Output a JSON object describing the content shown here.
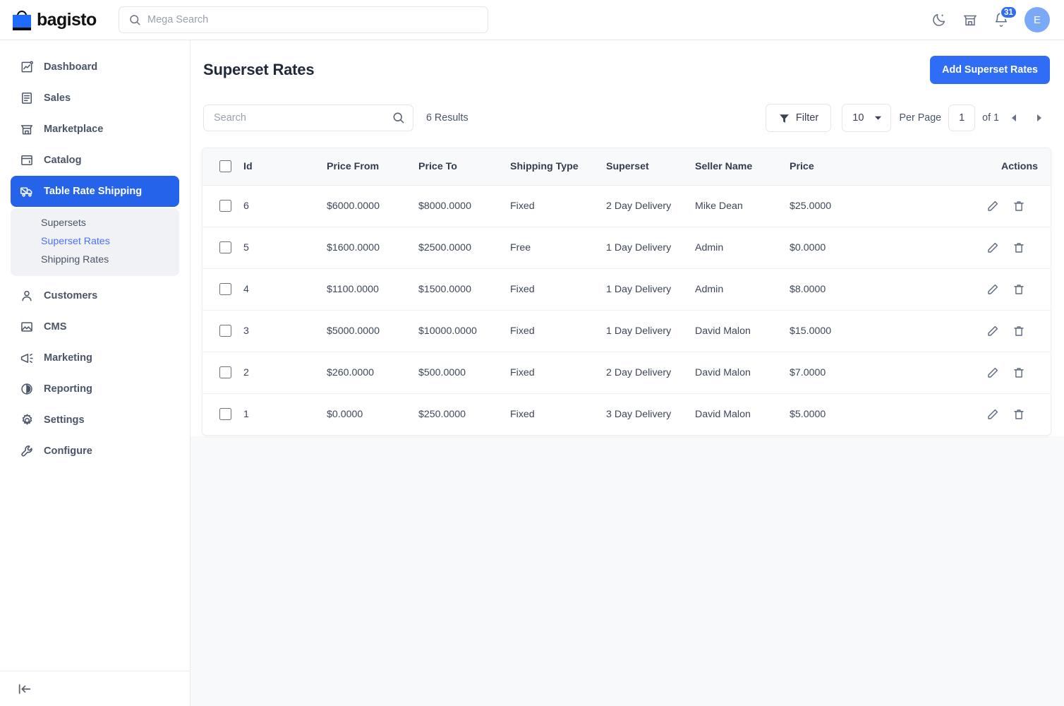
{
  "header": {
    "brand": "bagisto",
    "brand_logo_color": "#1f6bff",
    "mega_search_placeholder": "Mega Search",
    "icons": {
      "search": "search-icon",
      "dark_mode": "moon-icon",
      "store": "store-icon",
      "notifications": "bell-icon"
    },
    "notification_count": "31",
    "avatar_initial": "E"
  },
  "sidebar": {
    "items": [
      {
        "label": "Dashboard",
        "icon": "dashboard-chart-icon",
        "active": false
      },
      {
        "label": "Sales",
        "icon": "sales-list-icon",
        "active": false
      },
      {
        "label": "Marketplace",
        "icon": "marketplace-store-icon",
        "active": false
      },
      {
        "label": "Catalog",
        "icon": "catalog-window-icon",
        "active": false
      },
      {
        "label": "Table Rate Shipping",
        "icon": "truck-icon",
        "active": true
      },
      {
        "label": "Customers",
        "icon": "user-icon",
        "active": false
      },
      {
        "label": "CMS",
        "icon": "image-icon",
        "active": false
      },
      {
        "label": "Marketing",
        "icon": "megaphone-icon",
        "active": false
      },
      {
        "label": "Reporting",
        "icon": "pie-chart-icon",
        "active": false
      },
      {
        "label": "Settings",
        "icon": "gear-icon",
        "active": false
      },
      {
        "label": "Configure",
        "icon": "wrench-icon",
        "active": false
      }
    ],
    "submenu": [
      {
        "label": "Supersets",
        "active": false
      },
      {
        "label": "Superset Rates",
        "active": true
      },
      {
        "label": "Shipping Rates",
        "active": false
      }
    ],
    "collapse_icon": "collapse-sidebar-icon",
    "active_color": "#2563eb",
    "submenu_active_color": "#4c6fff"
  },
  "page": {
    "title": "Superset Rates",
    "add_button": "Add Superset Rates",
    "add_button_color": "#2f6df6"
  },
  "toolbar": {
    "search_placeholder": "Search",
    "search_value": "",
    "results_label": "6 Results",
    "filter_label": "Filter",
    "per_page_value": "10",
    "per_page_label": "Per Page",
    "page_value": "1",
    "of_label": "of 1",
    "prev_icon": "chevron-left-icon",
    "next_icon": "chevron-right-icon"
  },
  "table": {
    "columns": [
      "Id",
      "Price From",
      "Price To",
      "Shipping Type",
      "Superset",
      "Seller Name",
      "Price",
      "Actions"
    ],
    "rows": [
      {
        "id": "6",
        "price_from": "$6000.0000",
        "price_to": "$8000.0000",
        "shipping_type": "Fixed",
        "superset": "2 Day Delivery",
        "seller_name": "Mike Dean",
        "price": "$25.0000"
      },
      {
        "id": "5",
        "price_from": "$1600.0000",
        "price_to": "$2500.0000",
        "shipping_type": "Free",
        "superset": "1 Day Delivery",
        "seller_name": "Admin",
        "price": "$0.0000"
      },
      {
        "id": "4",
        "price_from": "$1100.0000",
        "price_to": "$1500.0000",
        "shipping_type": "Fixed",
        "superset": "1 Day Delivery",
        "seller_name": "Admin",
        "price": "$8.0000"
      },
      {
        "id": "3",
        "price_from": "$5000.0000",
        "price_to": "$10000.0000",
        "shipping_type": "Fixed",
        "superset": "1 Day Delivery",
        "seller_name": "David Malon",
        "price": "$15.0000"
      },
      {
        "id": "2",
        "price_from": "$260.0000",
        "price_to": "$500.0000",
        "shipping_type": "Fixed",
        "superset": "2 Day Delivery",
        "seller_name": "David Malon",
        "price": "$7.0000"
      },
      {
        "id": "1",
        "price_from": "$0.0000",
        "price_to": "$250.0000",
        "shipping_type": "Fixed",
        "superset": "3 Day Delivery",
        "seller_name": "David Malon",
        "price": "$5.0000"
      }
    ],
    "row_actions": {
      "edit_icon": "pencil-icon",
      "delete_icon": "trash-icon"
    }
  }
}
